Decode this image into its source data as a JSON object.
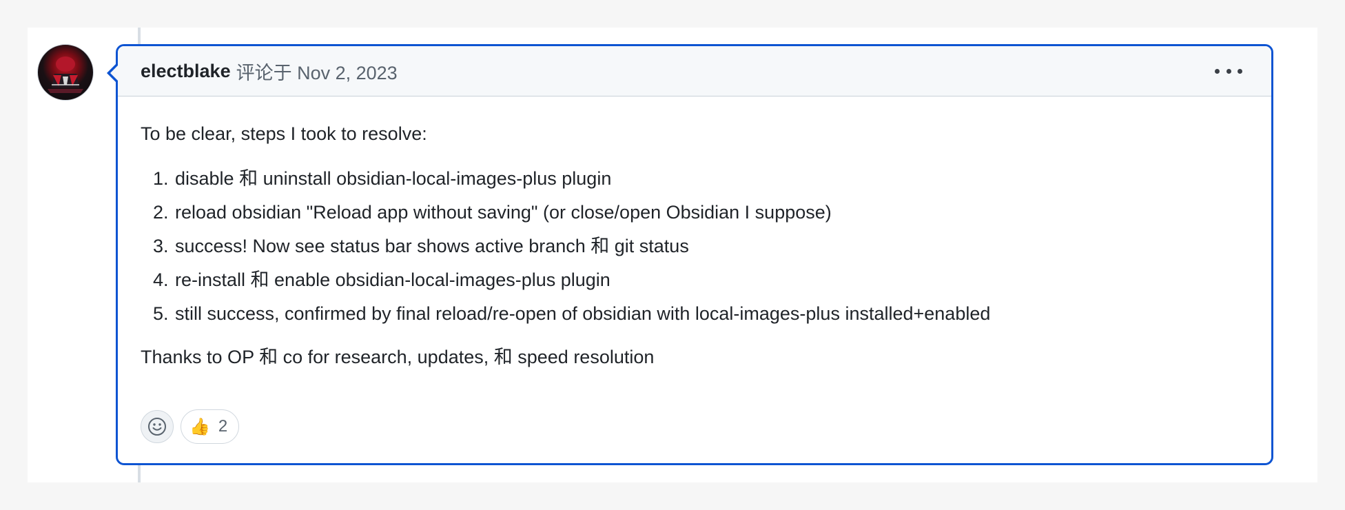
{
  "comment": {
    "author": "electblake",
    "meta": "评论于 Nov 2, 2023",
    "intro": "To be clear, steps I took to resolve:",
    "steps": [
      "disable 和 uninstall obsidian-local-images-plus plugin",
      "reload obsidian \"Reload app without saving\" (or close/open Obsidian I suppose)",
      "success! Now see status bar shows active branch 和 git status",
      "re-install 和 enable obsidian-local-images-plus plugin",
      "still success, confirmed by final reload/re-open of obsidian with local-images-plus installed+enabled"
    ],
    "outro": "Thanks to OP 和 co for research, updates, 和 speed resolution"
  },
  "reactions": {
    "add_icon": "smiley-icon",
    "items": [
      {
        "emoji": "👍",
        "icon": "thumbs-up-icon",
        "count": "2"
      }
    ]
  },
  "colors": {
    "accent_border": "#0d54d2",
    "header_bg": "#f6f8fa",
    "muted_text": "#59636e"
  }
}
